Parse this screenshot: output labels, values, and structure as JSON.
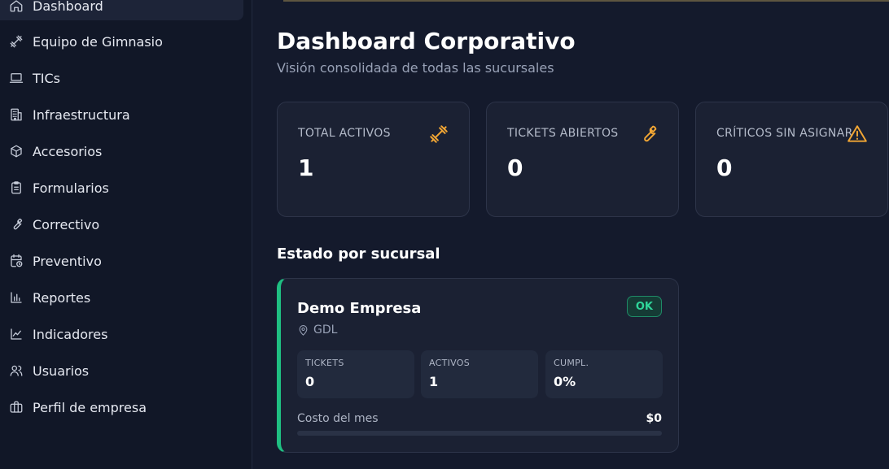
{
  "sidebar": {
    "items": [
      {
        "label": "Dashboard",
        "icon": "home-icon",
        "active": true
      },
      {
        "label": "Equipo de Gimnasio",
        "icon": "dumbbell-icon"
      },
      {
        "label": "TICs",
        "icon": "laptop-icon"
      },
      {
        "label": "Infraestructura",
        "icon": "building-icon"
      },
      {
        "label": "Accesorios",
        "icon": "box-icon"
      },
      {
        "label": "Formularios",
        "icon": "clipboard-icon"
      },
      {
        "label": "Correctivo",
        "icon": "wrench-icon"
      },
      {
        "label": "Preventivo",
        "icon": "calendar-clock-icon"
      },
      {
        "label": "Reportes",
        "icon": "bar-chart-icon"
      },
      {
        "label": "Indicadores",
        "icon": "line-chart-icon"
      },
      {
        "label": "Usuarios",
        "icon": "users-icon"
      },
      {
        "label": "Perfil de empresa",
        "icon": "briefcase-icon"
      }
    ]
  },
  "header": {
    "title": "Dashboard Corporativo",
    "subtitle": "Visión consolidada de todas las sucursales"
  },
  "kpis": [
    {
      "label": "TOTAL ACTIVOS",
      "value": "1",
      "icon": "dumbbell-icon"
    },
    {
      "label": "TICKETS ABIERTOS",
      "value": "0",
      "icon": "wrench-icon"
    },
    {
      "label": "CRÍTICOS SIN ASIGNAR",
      "value": "0",
      "icon": "warning-icon"
    }
  ],
  "branches": {
    "section_title": "Estado por sucursal",
    "items": [
      {
        "name": "Demo Empresa",
        "location": "GDL",
        "status": "OK",
        "stats": [
          {
            "label": "TICKETS",
            "value": "0"
          },
          {
            "label": "ACTIVOS",
            "value": "1"
          },
          {
            "label": "CUMPL.",
            "value": "0%"
          }
        ],
        "cost_label": "Costo del mes",
        "cost_value": "$0",
        "cost_progress": 0
      }
    ]
  },
  "colors": {
    "accent_orange": "#f2a634",
    "status_green": "#1fbf82",
    "background": "#141a2c",
    "card": "#1b2133"
  }
}
